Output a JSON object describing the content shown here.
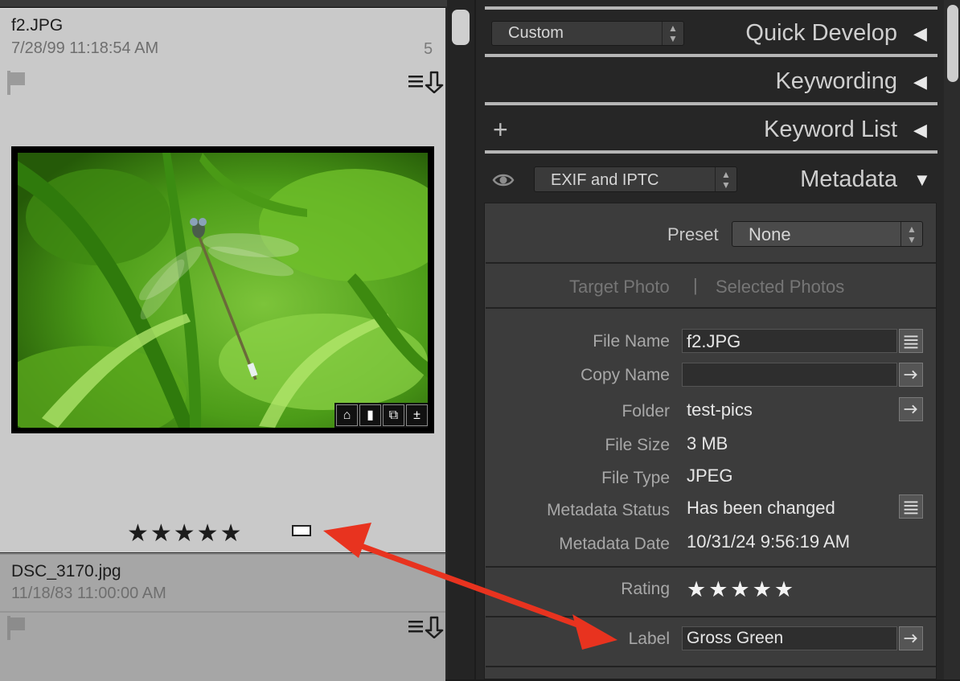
{
  "grid": {
    "items": [
      {
        "filename": "f2.JPG",
        "date": "7/28/99 11:18:54 AM",
        "index": "5",
        "stars": "★★★★★"
      },
      {
        "filename": "DSC_3170.jpg",
        "date": "11/18/83 11:00:00 AM"
      }
    ],
    "badge_glyphs": {
      "keyword": "⌂",
      "comment": "▮",
      "copy": "⧉",
      "develop": "±"
    }
  },
  "panel": {
    "quick_develop": {
      "preset": "Custom",
      "title": "Quick Develop",
      "toggle": "◀"
    },
    "keywording": {
      "title": "Keywording",
      "toggle": "◀"
    },
    "keyword_list": {
      "add": "+",
      "title": "Keyword List",
      "toggle": "◀"
    },
    "metadata": {
      "view": "EXIF and IPTC",
      "title": "Metadata",
      "toggle": "▼",
      "preset_label": "Preset",
      "preset_value": "None",
      "tab_target": "Target Photo",
      "tab_divider": "|",
      "tab_selected": "Selected Photos",
      "fields": {
        "file_name": {
          "label": "File Name",
          "value": "f2.JPG"
        },
        "copy_name": {
          "label": "Copy Name",
          "value": ""
        },
        "folder": {
          "label": "Folder",
          "value": "test-pics"
        },
        "file_size": {
          "label": "File Size",
          "value": "3 MB"
        },
        "file_type": {
          "label": "File Type",
          "value": "JPEG"
        },
        "metadata_status": {
          "label": "Metadata Status",
          "value": "Has been changed"
        },
        "metadata_date": {
          "label": "Metadata Date",
          "value": "10/31/24 9:56:19 AM"
        },
        "rating": {
          "label": "Rating",
          "value": "★★★★★"
        },
        "label": {
          "label": "Label",
          "value": "Gross Green"
        }
      }
    }
  },
  "colors": {
    "annotation_arrow": "#e8331f",
    "label_swatch": "#ffffff"
  }
}
